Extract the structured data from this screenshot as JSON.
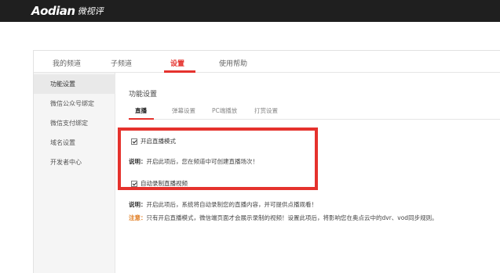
{
  "brand": {
    "logo_main": "Aodian",
    "logo_cn": "微视评"
  },
  "tabs": [
    {
      "label": "我的频道",
      "active": false
    },
    {
      "label": "子频道",
      "active": false
    },
    {
      "label": "设置",
      "active": true
    },
    {
      "label": "使用帮助",
      "active": false
    }
  ],
  "sidebar": {
    "items": [
      {
        "label": "功能设置",
        "active": true
      },
      {
        "label": "微信公众号绑定",
        "active": false
      },
      {
        "label": "微信支付绑定",
        "active": false
      },
      {
        "label": "域名设置",
        "active": false
      },
      {
        "label": "开发者中心",
        "active": false
      }
    ]
  },
  "content": {
    "title": "功能设置",
    "subtabs": [
      {
        "label": "直播",
        "active": true
      },
      {
        "label": "弹幕设置",
        "active": false
      },
      {
        "label": "PC端播放",
        "active": false
      },
      {
        "label": "打赏设置",
        "active": false
      }
    ],
    "live_mode": {
      "label": "开启直播模式",
      "checked": true
    },
    "live_desc": {
      "prefix": "说明：",
      "text": "开启此项后，您在频道中可创建直播场次！"
    },
    "auto_record": {
      "label": "自动录制直播视频",
      "checked": true
    },
    "record_desc": {
      "prefix": "说明：",
      "text": "开启此项后，系统将自动录制您的直播内容，并可提供点播观看！"
    },
    "note": {
      "prefix": "注意：",
      "text": "只有开启直播模式，微信端页面才会展示录制的视频！设置此项后，将影响您在奥点云中的dvr、vod同步规则。"
    }
  },
  "colors": {
    "accent": "#e5322d",
    "note": "#e07a1d",
    "topbar": "#1f1f1f"
  }
}
